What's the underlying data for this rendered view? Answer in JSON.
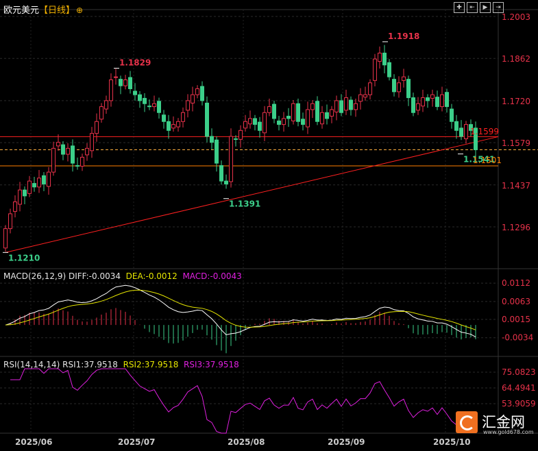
{
  "header": {
    "symbol": "欧元美元",
    "period": "【日线】",
    "add_icon": "plus-circle-icon"
  },
  "toolbar": {
    "icons": [
      "crosshair-icon",
      "zoom-left-icon",
      "zoom-right-icon",
      "move-right-icon"
    ]
  },
  "indicators": {
    "macd": {
      "label": "MACD(26,12,9)",
      "diff": "DIFF:-0.0034",
      "dea": "DEA:-0.0012",
      "macd": "MACD:-0.0043"
    },
    "rsi": {
      "label": "RSI(14,14,14)",
      "rsi1": "RSI1:37.9518",
      "rsi2": "RSI2:37.9518",
      "rsi3": "RSI3:37.9518"
    }
  },
  "logo": {
    "name": "汇金网",
    "url": "www.gold678.com"
  },
  "colors": {
    "up": "#e8324a",
    "down": "#3ccf8a",
    "trend": "#ff2020",
    "support": "#ff8000",
    "diff": "#ffffff",
    "dea": "#e6e600",
    "rsi": "#e020e0"
  },
  "chart_data": {
    "type": "candlestick",
    "price_ticks": [
      "1.2003",
      "1.1862",
      "1.1720",
      "1.1579",
      "1.1437",
      "1.1296"
    ],
    "ylim": [
      1.1296,
      1.2003
    ],
    "macd_ticks": [
      "0.0112",
      "0.0063",
      "0.0015",
      "-0.0034"
    ],
    "rsi_ticks": [
      "75.0823",
      "64.4941",
      "53.9059"
    ],
    "x_ticks": [
      "2025/06",
      "2025/07",
      "2025/08",
      "2025/09",
      "2025/10"
    ],
    "closes": [
      1.129,
      1.134,
      1.138,
      1.142,
      1.14,
      1.145,
      1.143,
      1.146,
      1.144,
      1.148,
      1.156,
      1.158,
      1.154,
      1.156,
      1.151,
      1.15,
      1.153,
      1.156,
      1.161,
      1.165,
      1.17,
      1.172,
      1.179,
      1.18,
      1.177,
      1.179,
      1.176,
      1.174,
      1.172,
      1.171,
      1.17,
      1.171,
      1.168,
      1.165,
      1.162,
      1.164,
      1.165,
      1.168,
      1.172,
      1.174,
      1.176,
      1.172,
      1.16,
      1.158,
      1.151,
      1.145,
      1.144,
      1.16,
      1.159,
      1.162,
      1.165,
      1.166,
      1.164,
      1.162,
      1.168,
      1.17,
      1.166,
      1.164,
      1.166,
      1.166,
      1.171,
      1.165,
      1.164,
      1.169,
      1.171,
      1.165,
      1.168,
      1.166,
      1.169,
      1.172,
      1.168,
      1.173,
      1.169,
      1.171,
      1.174,
      1.174,
      1.178,
      1.186,
      1.188,
      1.184,
      1.18,
      1.175,
      1.178,
      1.18,
      1.173,
      1.168,
      1.171,
      1.173,
      1.172,
      1.174,
      1.17,
      1.174,
      1.17,
      1.165,
      1.162,
      1.16,
      1.164,
      1.162,
      1.1555
    ],
    "annotations": [
      {
        "label": "1.1829",
        "price": 1.1829,
        "type": "high"
      },
      {
        "label": "1.1391",
        "price": 1.1391,
        "type": "low"
      },
      {
        "label": "1.1918",
        "price": 1.1918,
        "type": "high"
      },
      {
        "label": "1.1210",
        "price": 1.121,
        "type": "low"
      },
      {
        "label": "1.1541",
        "price": 1.1541,
        "type": "low"
      }
    ],
    "hlines": [
      {
        "label": "1.1599",
        "price": 1.1599,
        "style": "solid",
        "color": "#ff2020"
      },
      {
        "label": "1.1501",
        "price": 1.1501,
        "style": "solid",
        "color": "#ff8000"
      },
      {
        "price": 1.1555,
        "style": "dashed",
        "color": "#ffb040"
      }
    ],
    "trendline": {
      "from": 1.121,
      "to": 1.1599
    }
  }
}
